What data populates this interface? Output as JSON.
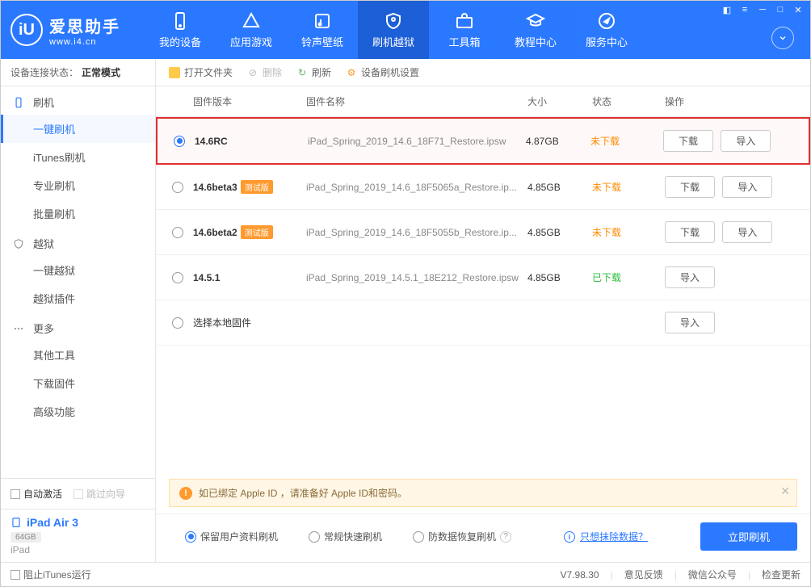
{
  "app": {
    "title": "爱思助手",
    "subtitle": "www.i4.cn"
  },
  "nav": [
    {
      "label": "我的设备"
    },
    {
      "label": "应用游戏"
    },
    {
      "label": "铃声壁纸"
    },
    {
      "label": "刷机越狱"
    },
    {
      "label": "工具箱"
    },
    {
      "label": "教程中心"
    },
    {
      "label": "服务中心"
    }
  ],
  "sidebar": {
    "status_label": "设备连接状态：",
    "status_value": "正常模式",
    "groups": [
      {
        "label": "刷机",
        "items": [
          "一键刷机",
          "iTunes刷机",
          "专业刷机",
          "批量刷机"
        ]
      },
      {
        "label": "越狱",
        "items": [
          "一键越狱",
          "越狱插件"
        ]
      },
      {
        "label": "更多",
        "items": [
          "其他工具",
          "下载固件",
          "高级功能"
        ]
      }
    ],
    "auto_activate": "自动激活",
    "skip_wizard": "跳过向导",
    "device_name": "iPad Air 3",
    "device_storage": "64GB",
    "device_type": "iPad"
  },
  "toolbar": {
    "open_folder": "打开文件夹",
    "delete": "删除",
    "refresh": "刷新",
    "settings": "设备刷机设置"
  },
  "table": {
    "headers": {
      "version": "固件版本",
      "name": "固件名称",
      "size": "大小",
      "status": "状态",
      "action": "操作"
    },
    "rows": [
      {
        "version": "14.6RC",
        "beta": "",
        "name": "iPad_Spring_2019_14.6_18F71_Restore.ipsw",
        "size": "4.87GB",
        "status": "未下载",
        "status_class": "undl",
        "selected": true
      },
      {
        "version": "14.6beta3",
        "beta": "测试版",
        "name": "iPad_Spring_2019_14.6_18F5065a_Restore.ip...",
        "size": "4.85GB",
        "status": "未下载",
        "status_class": "undl",
        "selected": false
      },
      {
        "version": "14.6beta2",
        "beta": "测试版",
        "name": "iPad_Spring_2019_14.6_18F5055b_Restore.ip...",
        "size": "4.85GB",
        "status": "未下载",
        "status_class": "undl",
        "selected": false
      },
      {
        "version": "14.5.1",
        "beta": "",
        "name": "iPad_Spring_2019_14.5.1_18E212_Restore.ipsw",
        "size": "4.85GB",
        "status": "已下载",
        "status_class": "dl",
        "selected": false
      }
    ],
    "local_label": "选择本地固件",
    "btn_download": "下载",
    "btn_import": "导入"
  },
  "notice": "如已绑定 Apple ID ，请准备好 Apple ID和密码。",
  "flash": {
    "opt1": "保留用户资料刷机",
    "opt2": "常规快速刷机",
    "opt3": "防数据恢复刷机",
    "erase_link": "只想抹除数据？",
    "flash_btn": "立即刷机"
  },
  "footer": {
    "itunes": "阻止iTunes运行",
    "version": "V7.98.30",
    "feedback": "意见反馈",
    "wechat": "微信公众号",
    "update": "检查更新"
  }
}
